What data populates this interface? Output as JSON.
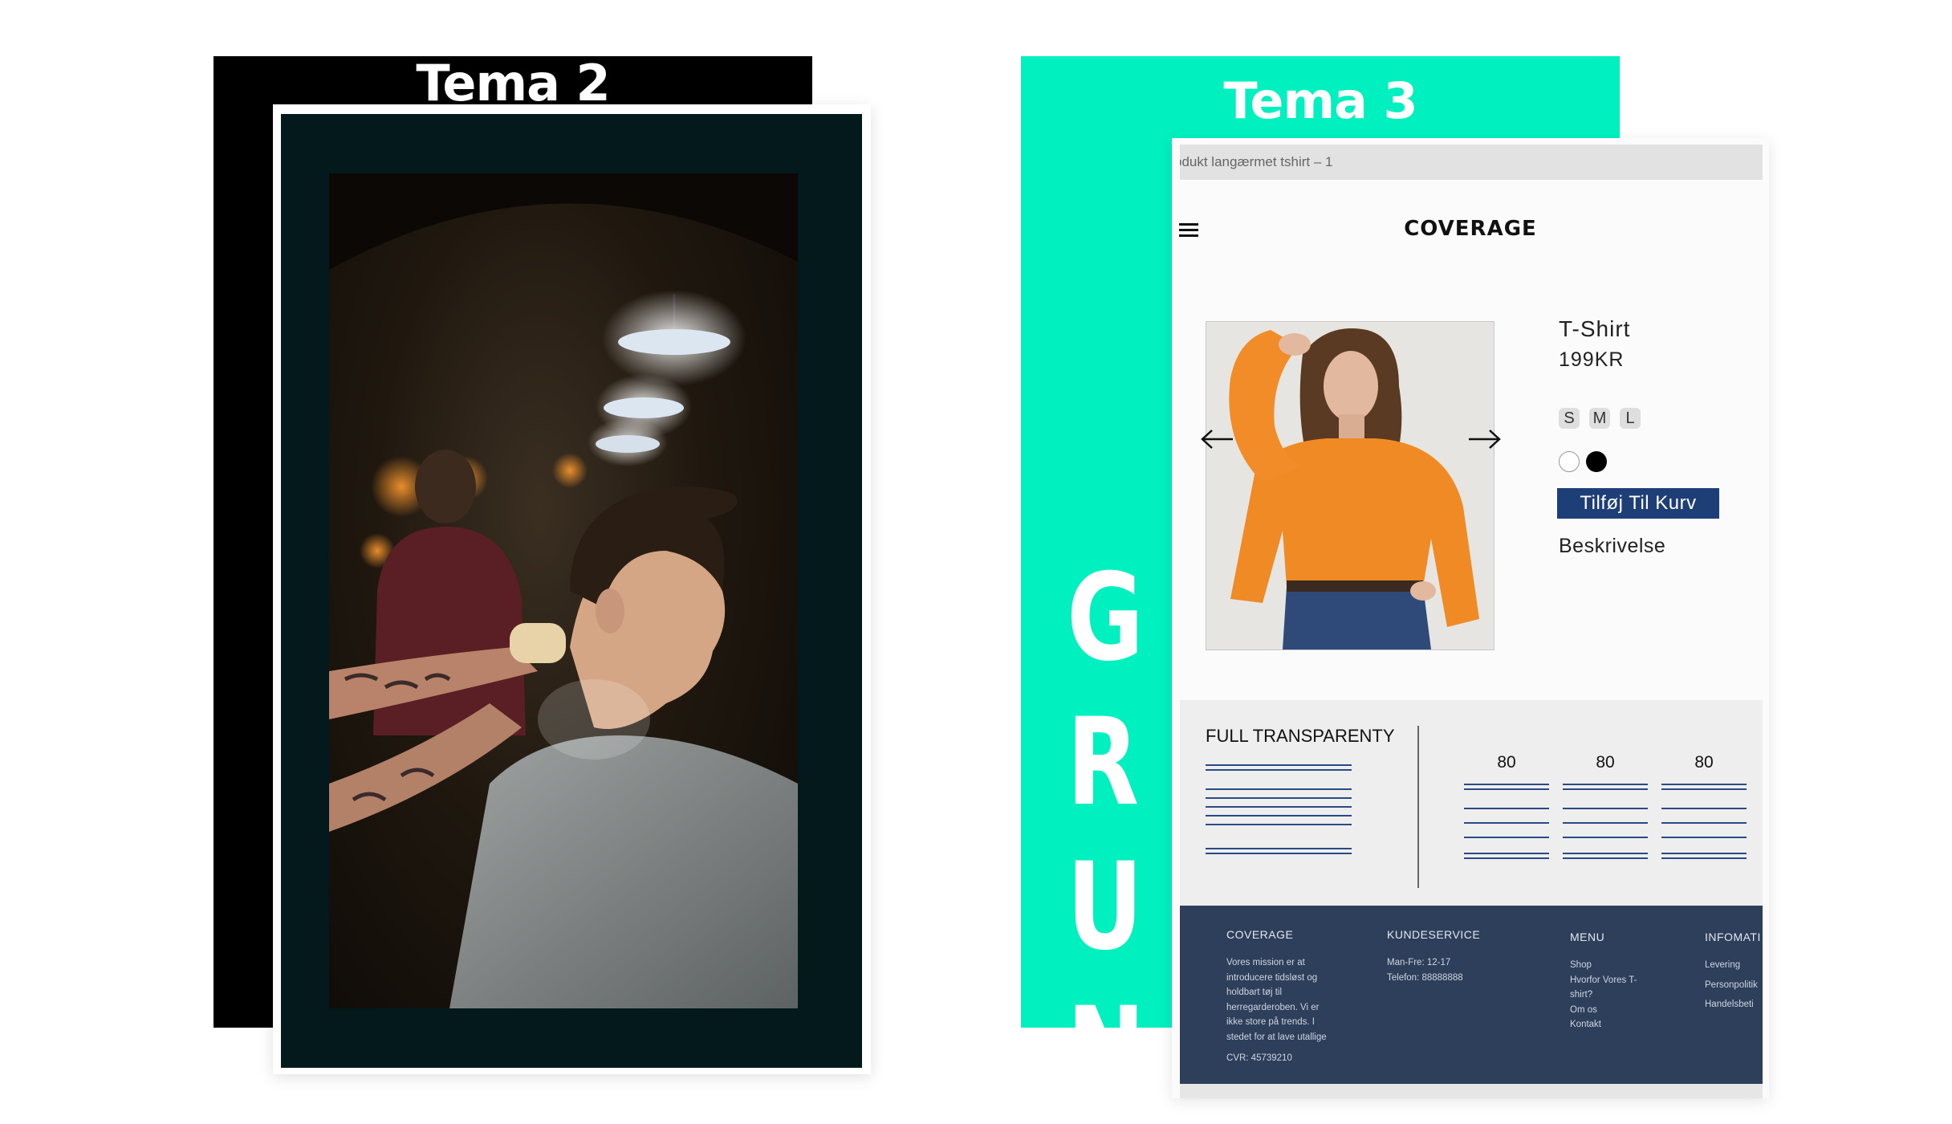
{
  "theme2": {
    "title": "Tema 2"
  },
  "theme3": {
    "title": "Tema 3",
    "vertical_letters": [
      "G",
      "R",
      "U",
      "N"
    ],
    "accent_color": "#00f0c0",
    "browser_bar_text": "odukt langærmet tshirt – 1",
    "menu_icon": "hamburger-icon",
    "brand": "COVERAGE",
    "product": {
      "name": "T-Shirt",
      "price": "199KR",
      "sizes": [
        "S",
        "M",
        "L"
      ],
      "colors": [
        "#ffffff",
        "#000000"
      ],
      "add_to_cart": "Tilføj Til Kurv",
      "description_label": "Beskrivelse",
      "prev_icon": "arrow-left-icon",
      "next_icon": "arrow-right-icon"
    },
    "transparency": {
      "title": "FULL TRANSPARENTY",
      "values": [
        "80",
        "80",
        "80"
      ]
    },
    "footer": {
      "columns": [
        {
          "heading": "COVERAGE",
          "lines": [
            "Vores mission er at",
            "introducere tidsløst og",
            "holdbart tøj til",
            "herregarderoben. Vi er",
            "ikke store på trends. I",
            "stedet for at lave utallige"
          ],
          "extra": "CVR: 45739210"
        },
        {
          "heading": "KUNDESERVICE",
          "lines": [
            "Man-Fre: 12-17",
            "Telefon: 88888888"
          ]
        },
        {
          "heading": "MENU",
          "lines": [
            "Shop",
            "Hvorfor Vores T-",
            "shirt?",
            "Om os",
            "Kontakt"
          ]
        },
        {
          "heading": "INFOMATI",
          "lines": [
            "Levering",
            "Personpolitik",
            "Handelsbeti"
          ]
        }
      ],
      "background_color": "#2e3f5c"
    }
  }
}
